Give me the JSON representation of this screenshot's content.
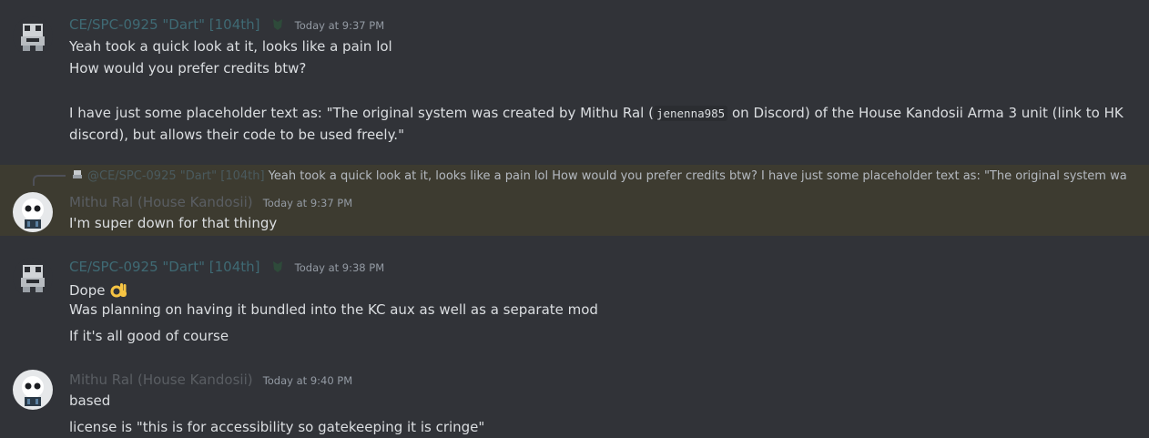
{
  "messages": [
    {
      "author": "CE/SPC-0925 \"Dart\" [104th]",
      "timestamp": "Today at 9:37 PM",
      "lines": [
        "Yeah took a quick look at it, looks like a pain lol",
        "How would you prefer credits btw?"
      ],
      "para_before": "I have just some placeholder text as: \"The original system was created by Mithu Ral (",
      "code": "jenenna985",
      "para_after": " on Discord) of the House Kandosii Arma 3 unit (link to HK",
      "para_line2": "discord), but allows their code to be used freely.\""
    },
    {
      "author": "Mithu Ral (House Kandosii)",
      "timestamp": "Today at 9:37 PM",
      "reply_author": "@CE/SPC-0925 \"Dart\" [104th]",
      "reply_text": "Yeah took a quick look at it, looks like a pain lol How would you prefer credits btw? I have just some placeholder text as: \"The original system was created by Mithu Ral",
      "lines": [
        "I'm super down for that thingy"
      ]
    },
    {
      "author": "CE/SPC-0925 \"Dart\" [104th]",
      "timestamp": "Today at 9:38 PM",
      "lines": [
        "Dope",
        "Was planning on having it bundled into the KC aux as well as a separate mod",
        "If it's all good of course"
      ],
      "emoji": "ok-hand"
    },
    {
      "author": "Mithu Ral (House Kandosii)",
      "timestamp": "Today at 9:40 PM",
      "lines": [
        "based",
        "license is \"this is for accessibility so gatekeeping it is cringe\""
      ]
    }
  ],
  "colors": {
    "background": "#313338",
    "highlight": "#3d3b30",
    "dart_name": "#3f6a74",
    "mithu_name": "#5a5e63",
    "timestamp": "#949ba4",
    "text": "#dbdee1"
  }
}
